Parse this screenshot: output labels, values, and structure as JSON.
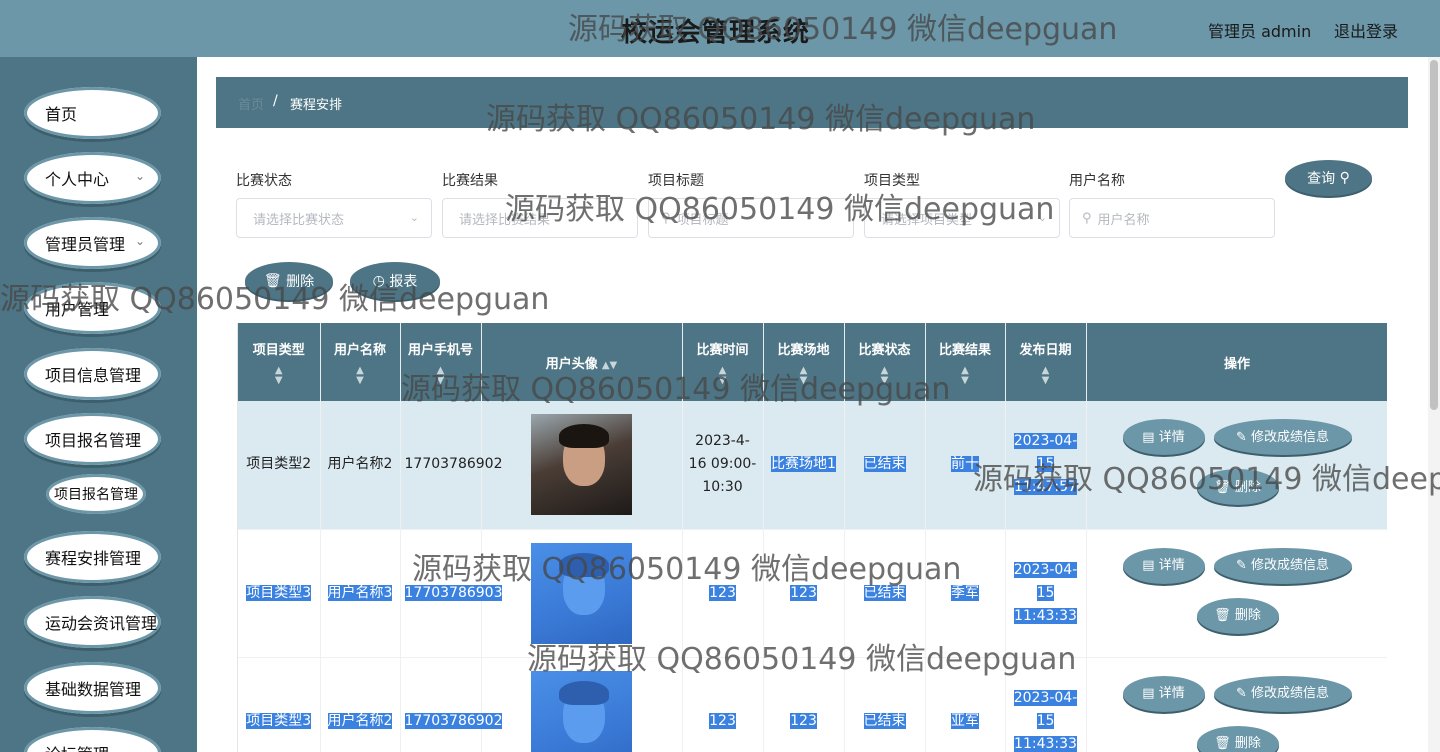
{
  "header": {
    "title": "校运会管理系统",
    "admin_label": "管理员 admin",
    "logout": "退出登录"
  },
  "sidebar": {
    "items": [
      {
        "label": "首页",
        "chevron": false
      },
      {
        "label": "个人中心",
        "chevron": true
      },
      {
        "label": "管理员管理",
        "chevron": true
      },
      {
        "label": "用户管理",
        "chevron": true
      },
      {
        "label": "项目信息管理",
        "chevron": false
      },
      {
        "label": "项目报名管理",
        "chevron": false
      },
      {
        "label": "赛程安排管理",
        "chevron": false
      },
      {
        "label": "运动会资讯管理",
        "chevron": false
      },
      {
        "label": "基础数据管理",
        "chevron": false
      },
      {
        "label": "论坛管理",
        "chevron": true
      }
    ],
    "sub_item": "项目报名管理"
  },
  "breadcrumb": {
    "home": "首页",
    "separator": "/",
    "current": "赛程安排"
  },
  "filters": [
    {
      "label": "比赛状态",
      "placeholder": "请选择比赛状态",
      "type": "select"
    },
    {
      "label": "比赛结果",
      "placeholder": "请选择比赛结果",
      "type": "select"
    },
    {
      "label": "项目标题",
      "placeholder": "项目标题",
      "type": "search"
    },
    {
      "label": "项目类型",
      "placeholder": "请选择项目类型",
      "type": "select"
    },
    {
      "label": "用户名称",
      "placeholder": "用户名称",
      "type": "search"
    }
  ],
  "buttons": {
    "query": "查询",
    "delete": "删除",
    "report": "报表"
  },
  "table": {
    "headers": [
      "项目类型",
      "用户名称",
      "用户手机号",
      "用户头像",
      "比赛时间",
      "比赛场地",
      "比赛状态",
      "比赛结果",
      "发布日期",
      "操作"
    ],
    "rows": [
      {
        "type": "项目类型2",
        "user": "用户名称2",
        "phone": "17703786902",
        "time": "2023-4-16 09:00-10:30",
        "venue": "比赛场地1",
        "status": "已结束",
        "result": "前十",
        "date": "2023-04-15 11:47:57"
      },
      {
        "type": "项目类型3",
        "user": "用户名称3",
        "phone": "17703786903",
        "time": "123",
        "venue": "123",
        "status": "已结束",
        "result": "季军",
        "date": "2023-04-15 11:43:33"
      },
      {
        "type": "项目类型3",
        "user": "用户名称2",
        "phone": "17703786902",
        "time": "123",
        "venue": "123",
        "status": "已结束",
        "result": "亚军",
        "date": "2023-04-15 11:43:33"
      }
    ],
    "actions": {
      "detail": "详情",
      "edit": "修改成绩信息",
      "delete": "删除"
    }
  },
  "watermark": "源码获取 QQ86050149 微信deepguan",
  "colors": {
    "header": "#6b97a8",
    "sidebar": "#4e7585",
    "selection": "#3b82e0",
    "highlight_row": "#dbeaf1"
  }
}
